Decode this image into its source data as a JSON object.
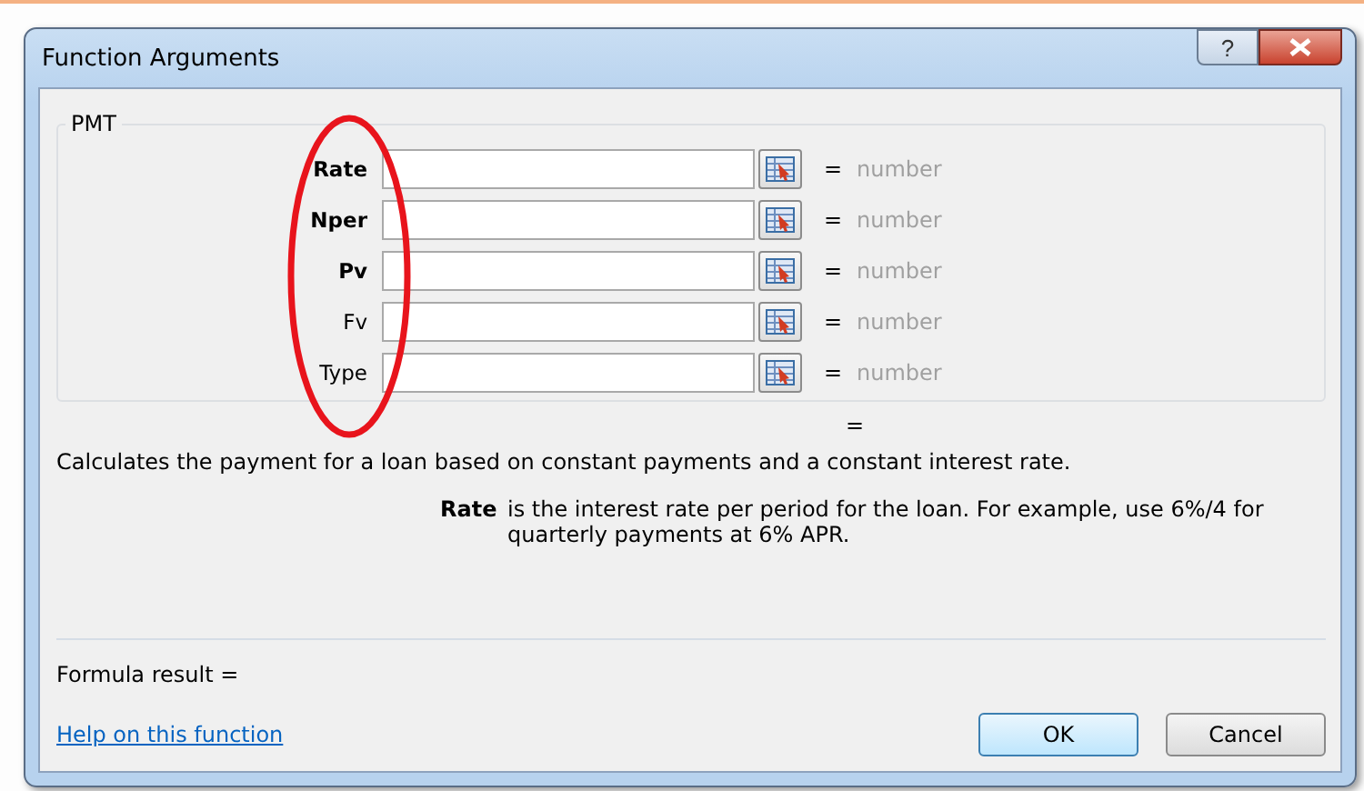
{
  "window": {
    "title": "Function Arguments",
    "help_button": "?"
  },
  "group": {
    "title": "PMT",
    "arguments": [
      {
        "label": "Rate",
        "required": true,
        "equals": "=",
        "result": "number"
      },
      {
        "label": "Nper",
        "required": true,
        "equals": "=",
        "result": "number"
      },
      {
        "label": "Pv",
        "required": true,
        "equals": "=",
        "result": "number"
      },
      {
        "label": "Fv",
        "required": false,
        "equals": "=",
        "result": "number"
      },
      {
        "label": "Type",
        "required": false,
        "equals": "=",
        "result": "number"
      }
    ]
  },
  "overall_equals": "=",
  "description": "Calculates the payment for a loan based on constant payments and a constant interest rate.",
  "argument_help": {
    "name": "Rate",
    "text": "is the interest rate per period for the loan. For example, use 6%/4 for quarterly payments at 6% APR."
  },
  "formula_result": "Formula result =",
  "help_link": "Help on this function",
  "buttons": [
    {
      "label": "OK",
      "default": true
    },
    {
      "label": "Cancel",
      "default": false
    }
  ]
}
